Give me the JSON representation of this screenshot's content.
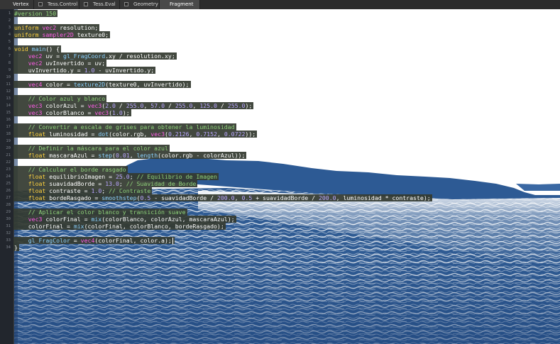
{
  "tabs": [
    {
      "label": "Vertex",
      "state": "plain"
    },
    {
      "label": "Tess.Control",
      "state": "checkbox"
    },
    {
      "label": "Tess.Eval",
      "state": "checkbox"
    },
    {
      "label": "Geometry",
      "state": "checkbox"
    },
    {
      "label": "Fragment",
      "state": "active"
    }
  ],
  "colors": {
    "sea": "#2f5b93",
    "sea_dark": "#1d4278",
    "land": "#2d5a94",
    "sky": "#ffffff",
    "code_highlight": "#343a30",
    "gutter": "#22262d"
  },
  "gutter": {
    "line_numbers": [
      "1",
      "2",
      "3",
      "4",
      "5",
      "6",
      "7",
      "8",
      "9",
      "10",
      "11",
      "12",
      "13",
      "14",
      "15",
      "16",
      "17",
      "18",
      "19",
      "20",
      "21",
      "22",
      "23",
      "24",
      "25",
      "26",
      "27",
      "28",
      "29",
      "30",
      "31",
      "32",
      "33",
      "34"
    ]
  },
  "code": {
    "lines": [
      [
        [
          "t-pp",
          "#version 150"
        ]
      ],
      [],
      [
        [
          "t-kw",
          "uniform "
        ],
        [
          "t-ty",
          "vec2"
        ],
        [
          "t-pl",
          " resolution;"
        ]
      ],
      [
        [
          "t-kw",
          "uniform "
        ],
        [
          "t-ty",
          "sampler2D"
        ],
        [
          "t-pl",
          " texture0;"
        ]
      ],
      [],
      [
        [
          "t-kw",
          "void "
        ],
        [
          "t-fn",
          "main"
        ],
        [
          "t-pl",
          "() {"
        ]
      ],
      [
        [
          "t-pl",
          "    "
        ],
        [
          "t-ty",
          "vec2"
        ],
        [
          "t-pl",
          " uv = "
        ],
        [
          "t-fn",
          "gl_FragCoord"
        ],
        [
          "t-pl",
          ".xy / resolution.xy;"
        ]
      ],
      [
        [
          "t-pl",
          "    "
        ],
        [
          "t-ty",
          "vec2"
        ],
        [
          "t-pl",
          " uvInvertido = uv;"
        ]
      ],
      [
        [
          "t-pl",
          "    uvInvertido.y = "
        ],
        [
          "t-num",
          "1.0"
        ],
        [
          "t-pl",
          " - uvInvertido.y;"
        ]
      ],
      [],
      [
        [
          "t-pl",
          "    "
        ],
        [
          "t-ty",
          "vec4"
        ],
        [
          "t-pl",
          " color = "
        ],
        [
          "t-fn",
          "texture2D"
        ],
        [
          "t-pl",
          "(texture0, uvInvertido);"
        ]
      ],
      [],
      [
        [
          "t-cm",
          "    // Color azul y blanco"
        ]
      ],
      [
        [
          "t-pl",
          "    "
        ],
        [
          "t-ty",
          "vec3"
        ],
        [
          "t-pl",
          " colorAzul = "
        ],
        [
          "t-ty",
          "vec3"
        ],
        [
          "t-pl",
          "("
        ],
        [
          "t-num",
          "2.0"
        ],
        [
          "t-pl",
          " / "
        ],
        [
          "t-num",
          "255.0"
        ],
        [
          "t-pl",
          ", "
        ],
        [
          "t-num",
          "57.0"
        ],
        [
          "t-pl",
          " / "
        ],
        [
          "t-num",
          "255.0"
        ],
        [
          "t-pl",
          ", "
        ],
        [
          "t-num",
          "125.0"
        ],
        [
          "t-pl",
          " / "
        ],
        [
          "t-num",
          "255.0"
        ],
        [
          "t-pl",
          ");"
        ]
      ],
      [
        [
          "t-pl",
          "    "
        ],
        [
          "t-ty",
          "vec3"
        ],
        [
          "t-pl",
          " colorBlanco = "
        ],
        [
          "t-ty",
          "vec3"
        ],
        [
          "t-pl",
          "("
        ],
        [
          "t-num",
          "1.0"
        ],
        [
          "t-pl",
          ");"
        ]
      ],
      [],
      [
        [
          "t-cm",
          "    // Convertir a escala de grises para obtener la luminosidad"
        ]
      ],
      [
        [
          "t-pl",
          "    "
        ],
        [
          "t-kw",
          "float"
        ],
        [
          "t-pl",
          " luminosidad = "
        ],
        [
          "t-fn",
          "dot"
        ],
        [
          "t-pl",
          "(color.rgb, "
        ],
        [
          "t-ty",
          "vec3"
        ],
        [
          "t-pl",
          "("
        ],
        [
          "t-num",
          "0.2126"
        ],
        [
          "t-pl",
          ", "
        ],
        [
          "t-num",
          "0.7152"
        ],
        [
          "t-pl",
          ", "
        ],
        [
          "t-num",
          "0.0722"
        ],
        [
          "t-pl",
          "));"
        ]
      ],
      [],
      [
        [
          "t-cm",
          "    // Definir la máscara para el color azul"
        ]
      ],
      [
        [
          "t-pl",
          "    "
        ],
        [
          "t-kw",
          "float"
        ],
        [
          "t-pl",
          " mascaraAzul = "
        ],
        [
          "t-fn",
          "step"
        ],
        [
          "t-pl",
          "("
        ],
        [
          "t-num",
          "0.01"
        ],
        [
          "t-pl",
          ", "
        ],
        [
          "t-fn",
          "length"
        ],
        [
          "t-pl",
          "(color.rgb - colorAzul));"
        ]
      ],
      [],
      [
        [
          "t-cm",
          "    // Calcular el borde rasgado"
        ]
      ],
      [
        [
          "t-pl",
          "    "
        ],
        [
          "t-kw",
          "float"
        ],
        [
          "t-pl",
          " equilibrioImagen = "
        ],
        [
          "t-num",
          "25.0"
        ],
        [
          "t-pl",
          "; "
        ],
        [
          "t-cm",
          "// Equilibrio de Imagen"
        ]
      ],
      [
        [
          "t-pl",
          "    "
        ],
        [
          "t-kw",
          "float"
        ],
        [
          "t-pl",
          " suavidadBorde = "
        ],
        [
          "t-num",
          "13.0"
        ],
        [
          "t-pl",
          "; "
        ],
        [
          "t-cm",
          "// Suavidad de Borde"
        ]
      ],
      [
        [
          "t-pl",
          "    "
        ],
        [
          "t-kw",
          "float"
        ],
        [
          "t-pl",
          " contraste = "
        ],
        [
          "t-num",
          "1.0"
        ],
        [
          "t-pl",
          "; "
        ],
        [
          "t-cm",
          "// Contraste"
        ]
      ],
      [
        [
          "t-pl",
          "    "
        ],
        [
          "t-kw",
          "float"
        ],
        [
          "t-pl",
          " bordeRasgado = "
        ],
        [
          "t-fn",
          "smoothstep"
        ],
        [
          "t-pl",
          "("
        ],
        [
          "t-num",
          "0.5"
        ],
        [
          "t-pl",
          " - suavidadBorde / "
        ],
        [
          "t-num",
          "200.0"
        ],
        [
          "t-pl",
          ", "
        ],
        [
          "t-num",
          "0.5"
        ],
        [
          "t-pl",
          " + suavidadBorde / "
        ],
        [
          "t-num",
          "200.0"
        ],
        [
          "t-pl",
          ", luminosidad * contraste);"
        ]
      ],
      [],
      [
        [
          "t-cm",
          "    // Aplicar el color blanco y transición suave"
        ]
      ],
      [
        [
          "t-pl",
          "    "
        ],
        [
          "t-ty",
          "vec3"
        ],
        [
          "t-pl",
          " colorFinal = "
        ],
        [
          "t-fn",
          "mix"
        ],
        [
          "t-pl",
          "(colorBlanco, colorAzul, mascaraAzul);"
        ]
      ],
      [
        [
          "t-pl",
          "    colorFinal = "
        ],
        [
          "t-fn",
          "mix"
        ],
        [
          "t-pl",
          "(colorFinal, colorBlanco, bordeRasgado);"
        ]
      ],
      [],
      [
        [
          "t-pl",
          "    "
        ],
        [
          "t-fn",
          "gl_FragColor"
        ],
        [
          "t-pl",
          " = "
        ],
        [
          "t-ty",
          "vec4"
        ],
        [
          "t-pl",
          "(colorFinal, color.a);"
        ]
      ],
      [
        [
          "t-pl",
          "}"
        ]
      ]
    ],
    "caret_line": 32
  }
}
